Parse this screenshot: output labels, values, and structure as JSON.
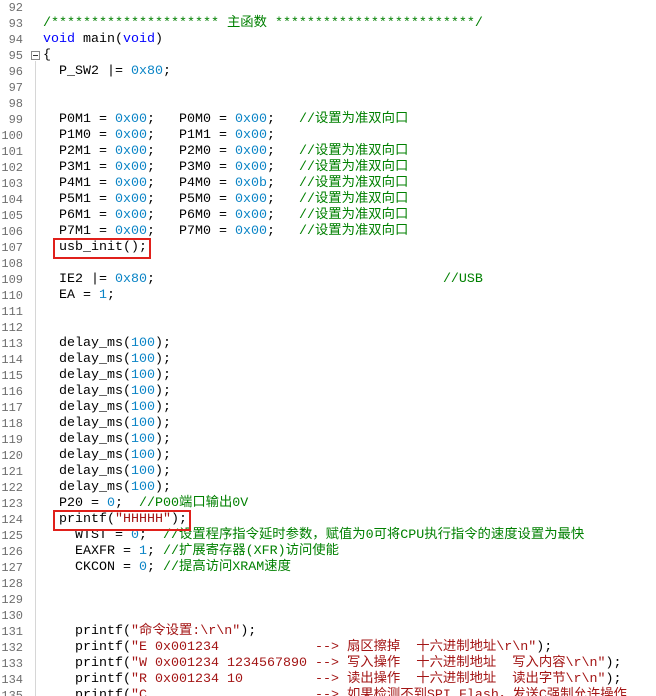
{
  "colors": {
    "plain": "#000000",
    "keyword": "#0000ff",
    "number": "#0a84c6",
    "comment": "#008000",
    "string": "#a31515",
    "line_number": "#6e6e6e",
    "highlight_box": "#e0201b"
  },
  "editor": {
    "lines": [
      {
        "n": 92,
        "tokens": []
      },
      {
        "n": 93,
        "tokens": [
          {
            "comment": "/********************* 主函数 *************************/"
          }
        ]
      },
      {
        "n": 94,
        "tokens": [
          {
            "keyword": "void"
          },
          {
            "plain": " main("
          },
          {
            "keyword": "void"
          },
          {
            "plain": ")"
          }
        ]
      },
      {
        "n": 95,
        "fold": true,
        "tokens": [
          {
            "plain": "{"
          }
        ]
      },
      {
        "n": 96,
        "indent": "  ",
        "tokens": [
          {
            "plain": "P_SW2 |= "
          },
          {
            "number": "0x80"
          },
          {
            "plain": ";"
          }
        ]
      },
      {
        "n": 97,
        "tokens": []
      },
      {
        "n": 98,
        "tokens": []
      },
      {
        "n": 99,
        "indent": "  ",
        "tokens": [
          {
            "plain": "P0M1 = "
          },
          {
            "number": "0x00"
          },
          {
            "plain": ";   P0M0 = "
          },
          {
            "number": "0x00"
          },
          {
            "plain": ";   "
          },
          {
            "comment": "//设置为准双向口"
          }
        ]
      },
      {
        "n": 100,
        "indent": "  ",
        "tokens": [
          {
            "plain": "P1M0 = "
          },
          {
            "number": "0x00"
          },
          {
            "plain": ";   P1M1 = "
          },
          {
            "number": "0x00"
          },
          {
            "plain": ";"
          }
        ]
      },
      {
        "n": 101,
        "indent": "  ",
        "tokens": [
          {
            "plain": "P2M1 = "
          },
          {
            "number": "0x00"
          },
          {
            "plain": ";   P2M0 = "
          },
          {
            "number": "0x00"
          },
          {
            "plain": ";   "
          },
          {
            "comment": "//设置为准双向口"
          }
        ]
      },
      {
        "n": 102,
        "indent": "  ",
        "tokens": [
          {
            "plain": "P3M1 = "
          },
          {
            "number": "0x00"
          },
          {
            "plain": ";   P3M0 = "
          },
          {
            "number": "0x00"
          },
          {
            "plain": ";   "
          },
          {
            "comment": "//设置为准双向口"
          }
        ]
      },
      {
        "n": 103,
        "indent": "  ",
        "tokens": [
          {
            "plain": "P4M1 = "
          },
          {
            "number": "0x00"
          },
          {
            "plain": ";   P4M0 = "
          },
          {
            "number": "0x0b"
          },
          {
            "plain": ";   "
          },
          {
            "comment": "//设置为准双向口"
          }
        ]
      },
      {
        "n": 104,
        "indent": "  ",
        "tokens": [
          {
            "plain": "P5M1 = "
          },
          {
            "number": "0x00"
          },
          {
            "plain": ";   P5M0 = "
          },
          {
            "number": "0x00"
          },
          {
            "plain": ";   "
          },
          {
            "comment": "//设置为准双向口"
          }
        ]
      },
      {
        "n": 105,
        "indent": "  ",
        "tokens": [
          {
            "plain": "P6M1 = "
          },
          {
            "number": "0x00"
          },
          {
            "plain": ";   P6M0 = "
          },
          {
            "number": "0x00"
          },
          {
            "plain": ";   "
          },
          {
            "comment": "//设置为准双向口"
          }
        ]
      },
      {
        "n": 106,
        "indent": "  ",
        "tokens": [
          {
            "plain": "P7M1 = "
          },
          {
            "number": "0x00"
          },
          {
            "plain": ";   P7M0 = "
          },
          {
            "number": "0x00"
          },
          {
            "plain": ";   "
          },
          {
            "comment": "//设置为准双向口"
          }
        ]
      },
      {
        "n": 107,
        "indent": "  ",
        "boxed": true,
        "tokens": [
          {
            "plain": "usb_init();"
          }
        ]
      },
      {
        "n": 108,
        "tokens": []
      },
      {
        "n": 109,
        "indent": "  ",
        "tokens": [
          {
            "plain": "IE2 |= "
          },
          {
            "number": "0x80"
          },
          {
            "plain": ";                                    "
          },
          {
            "comment": "//USB"
          }
        ]
      },
      {
        "n": 110,
        "indent": "  ",
        "tokens": [
          {
            "plain": "EA = "
          },
          {
            "number": "1"
          },
          {
            "plain": ";"
          }
        ]
      },
      {
        "n": 111,
        "tokens": []
      },
      {
        "n": 112,
        "tokens": []
      },
      {
        "n": 113,
        "indent": "  ",
        "tokens": [
          {
            "plain": "delay_ms("
          },
          {
            "number": "100"
          },
          {
            "plain": ");"
          }
        ]
      },
      {
        "n": 114,
        "indent": "  ",
        "tokens": [
          {
            "plain": "delay_ms("
          },
          {
            "number": "100"
          },
          {
            "plain": ");"
          }
        ]
      },
      {
        "n": 115,
        "indent": "  ",
        "tokens": [
          {
            "plain": "delay_ms("
          },
          {
            "number": "100"
          },
          {
            "plain": ");"
          }
        ]
      },
      {
        "n": 116,
        "indent": "  ",
        "tokens": [
          {
            "plain": "delay_ms("
          },
          {
            "number": "100"
          },
          {
            "plain": ");"
          }
        ]
      },
      {
        "n": 117,
        "indent": "  ",
        "tokens": [
          {
            "plain": "delay_ms("
          },
          {
            "number": "100"
          },
          {
            "plain": ");"
          }
        ]
      },
      {
        "n": 118,
        "indent": "  ",
        "tokens": [
          {
            "plain": "delay_ms("
          },
          {
            "number": "100"
          },
          {
            "plain": ");"
          }
        ]
      },
      {
        "n": 119,
        "indent": "  ",
        "tokens": [
          {
            "plain": "delay_ms("
          },
          {
            "number": "100"
          },
          {
            "plain": ");"
          }
        ]
      },
      {
        "n": 120,
        "indent": "  ",
        "tokens": [
          {
            "plain": "delay_ms("
          },
          {
            "number": "100"
          },
          {
            "plain": ");"
          }
        ]
      },
      {
        "n": 121,
        "indent": "  ",
        "tokens": [
          {
            "plain": "delay_ms("
          },
          {
            "number": "100"
          },
          {
            "plain": ");"
          }
        ]
      },
      {
        "n": 122,
        "indent": "  ",
        "tokens": [
          {
            "plain": "delay_ms("
          },
          {
            "number": "100"
          },
          {
            "plain": ");"
          }
        ]
      },
      {
        "n": 123,
        "indent": "  ",
        "tokens": [
          {
            "plain": "P20 = "
          },
          {
            "number": "0"
          },
          {
            "plain": ";  "
          },
          {
            "comment": "//P00端口输出0V"
          }
        ]
      },
      {
        "n": 124,
        "indent": "  ",
        "boxed": true,
        "tokens": [
          {
            "plain": "printf("
          },
          {
            "string": "\"HHHHH\""
          },
          {
            "plain": ");"
          }
        ]
      },
      {
        "n": 125,
        "indent": "    ",
        "tokens": [
          {
            "plain": "WTST = "
          },
          {
            "number": "0"
          },
          {
            "plain": ";  "
          },
          {
            "comment": "//设置程序指令延时参数，赋值为0可将CPU执行指令的速度设置为最快"
          }
        ]
      },
      {
        "n": 126,
        "indent": "    ",
        "tokens": [
          {
            "plain": "EAXFR = "
          },
          {
            "number": "1"
          },
          {
            "plain": "; "
          },
          {
            "comment": "//扩展寄存器(XFR)访问使能"
          }
        ]
      },
      {
        "n": 127,
        "indent": "    ",
        "tokens": [
          {
            "plain": "CKCON = "
          },
          {
            "number": "0"
          },
          {
            "plain": "; "
          },
          {
            "comment": "//提高访问XRAM速度"
          }
        ]
      },
      {
        "n": 128,
        "tokens": []
      },
      {
        "n": 129,
        "tokens": []
      },
      {
        "n": 130,
        "tokens": []
      },
      {
        "n": 131,
        "indent": "    ",
        "tokens": [
          {
            "plain": "printf("
          },
          {
            "string": "\"命令设置:\\r\\n\""
          },
          {
            "plain": ");"
          }
        ]
      },
      {
        "n": 132,
        "indent": "    ",
        "tokens": [
          {
            "plain": "printf("
          },
          {
            "string": "\"E 0x001234            --> 扇区擦掉  十六进制地址\\r\\n\""
          },
          {
            "plain": ");"
          }
        ]
      },
      {
        "n": 133,
        "indent": "    ",
        "tokens": [
          {
            "plain": "printf("
          },
          {
            "string": "\"W 0x001234 1234567890 --> 写入操作  十六进制地址  写入内容\\r\\n\""
          },
          {
            "plain": ");"
          }
        ]
      },
      {
        "n": 134,
        "indent": "    ",
        "tokens": [
          {
            "plain": "printf("
          },
          {
            "string": "\"R 0x001234 10         --> 读出操作  十六进制地址  读出字节\\r\\n\""
          },
          {
            "plain": ");"
          }
        ]
      },
      {
        "n": 135,
        "indent": "    ",
        "tokens": [
          {
            "plain": "printf("
          },
          {
            "string": "\"C                     --> 如果检测不到SPI Flash，发送C强制允许操作"
          }
        ]
      }
    ]
  }
}
